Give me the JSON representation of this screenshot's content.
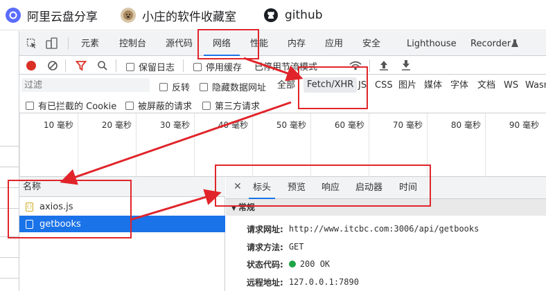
{
  "bookmarks": [
    {
      "label": "阿里云盘分享",
      "icon": "aliyun-drive-icon"
    },
    {
      "label": "小庄的软件收藏室",
      "icon": "dog-avatar-icon"
    },
    {
      "label": "github",
      "icon": "github-icon"
    }
  ],
  "devtools": {
    "tabs": [
      "元素",
      "控制台",
      "源代码",
      "网络",
      "性能",
      "内存",
      "应用",
      "安全",
      "Lighthouse",
      "Recorder"
    ],
    "active_tab": "网络",
    "toolbar": {
      "preserve_log": "保留日志",
      "disable_cache": "停用缓存",
      "throttling": "已停用节流模式"
    },
    "filter": {
      "placeholder": "过滤",
      "invert": "反转",
      "hide_data_urls": "隐藏数据网址",
      "types": [
        "全部",
        "Fetch/XHR",
        "JS",
        "CSS",
        "图片",
        "媒体",
        "字体",
        "文档",
        "WS",
        "Wasm"
      ],
      "active_type": "Fetch/XHR",
      "blocked_cookies": "有已拦截的 Cookie",
      "blocked_requests": "被屏蔽的请求",
      "third_party": "第三方请求"
    },
    "timeline_ticks": [
      "10 毫秒",
      "20 毫秒",
      "30 毫秒",
      "40 毫秒",
      "50 毫秒",
      "60 毫秒",
      "70 毫秒",
      "80 毫秒",
      "90 毫秒"
    ],
    "name_column": "名称",
    "requests": [
      {
        "name": "axios.js",
        "selected": false
      },
      {
        "name": "getbooks",
        "selected": true
      }
    ],
    "detail_tabs": [
      "标头",
      "预览",
      "响应",
      "启动器",
      "时间"
    ],
    "active_detail_tab": "标头",
    "general_section": "常规",
    "general": {
      "url_label": "请求网址:",
      "url": "http://www.itcbc.com:3006/api/getbooks",
      "method_label": "请求方法:",
      "method": "GET",
      "status_label": "状态代码:",
      "status": "200 OK",
      "remote_label": "远程地址:",
      "remote": "127.0.0.1:7890"
    }
  },
  "colors": {
    "accent": "#1a73e8",
    "annotation": "#e0242a",
    "status_ok": "#1ea446",
    "record": "#d93025"
  }
}
